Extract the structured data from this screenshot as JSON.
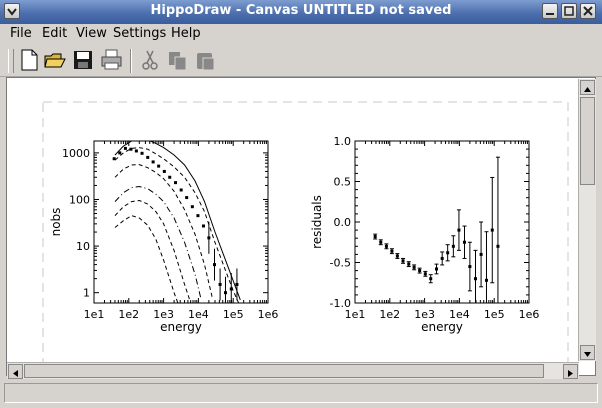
{
  "window": {
    "title": "HippoDraw - Canvas UNTITLED   not saved"
  },
  "menu": {
    "file": "File",
    "edit": "Edit",
    "view": "View",
    "settings": "Settings",
    "help": "Help"
  },
  "toolbar": {
    "icons": [
      "new-file-icon",
      "open-folder-icon",
      "save-icon",
      "print-icon",
      "cut-icon",
      "copy-icon",
      "paste-icon"
    ]
  },
  "chart_data": [
    {
      "type": "line",
      "xlabel": "energy",
      "ylabel": "nobs",
      "xscale": "log",
      "yscale": "log",
      "xticks": [
        "1e1",
        "1e2",
        "1e3",
        "1e4",
        "1e5",
        "1e6"
      ],
      "yticks": [
        "1",
        "10",
        "100",
        "1000"
      ],
      "xlim": [
        10,
        1000000
      ],
      "ylim": [
        0.6,
        1800
      ],
      "points": {
        "x": [
          38,
          55,
          80,
          115,
          165,
          240,
          350,
          500,
          720,
          1050,
          1500,
          2200,
          3200,
          4600,
          6700,
          9700,
          14000,
          20000,
          29000,
          42000,
          60000,
          88000,
          128000
        ],
        "y": [
          750,
          1000,
          1250,
          1200,
          1100,
          980,
          800,
          640,
          520,
          400,
          300,
          230,
          160,
          110,
          70,
          45,
          27,
          15,
          4,
          1.5,
          1.0,
          1.2,
          1.5
        ]
      },
      "curves": [
        {
          "style": "solid",
          "x": [
            40,
            70,
            120,
            200,
            350,
            600,
            1000,
            2000,
            4000,
            8000,
            15000,
            30000,
            60000,
            100000,
            160000
          ],
          "y": [
            900,
            1400,
            1800,
            2000,
            1900,
            1600,
            1300,
            900,
            550,
            250,
            90,
            20,
            5,
            1.8,
            0.7
          ]
        },
        {
          "style": "dashed",
          "x": [
            40,
            70,
            120,
            200,
            350,
            600,
            1000,
            2000,
            4000,
            8000,
            15000,
            30000,
            60000,
            100000,
            160000
          ],
          "y": [
            700,
            1000,
            1250,
            1300,
            1200,
            950,
            750,
            500,
            300,
            140,
            55,
            12,
            3,
            1.1,
            0.5
          ]
        },
        {
          "style": "dashed",
          "x": [
            40,
            70,
            120,
            200,
            350,
            600,
            1000,
            2000,
            4000,
            8000,
            15000,
            25000
          ],
          "y": [
            300,
            450,
            550,
            560,
            480,
            380,
            280,
            150,
            60,
            18,
            4,
            0.8
          ]
        },
        {
          "style": "dash-dot",
          "x": [
            40,
            70,
            120,
            200,
            350,
            600,
            1000,
            2000,
            4000,
            8000,
            12000
          ],
          "y": [
            90,
            140,
            180,
            190,
            170,
            130,
            90,
            40,
            12,
            2.5,
            0.7
          ]
        },
        {
          "style": "dashed",
          "x": [
            40,
            70,
            120,
            200,
            350,
            600,
            1000,
            2000,
            4000,
            6000
          ],
          "y": [
            45,
            70,
            90,
            95,
            80,
            55,
            30,
            8,
            1.5,
            0.6
          ]
        },
        {
          "style": "dashed",
          "x": [
            40,
            70,
            120,
            200,
            350,
            600,
            1000,
            2000,
            2800
          ],
          "y": [
            25,
            35,
            45,
            40,
            28,
            14,
            5,
            1.0,
            0.5
          ]
        }
      ]
    },
    {
      "type": "scatter",
      "xlabel": "energy",
      "ylabel": "residuals",
      "xscale": "log",
      "xticks": [
        "1e1",
        "1e2",
        "1e3",
        "1e4",
        "1e5",
        "1e6"
      ],
      "yticks": [
        "-1.0",
        "-0.5",
        "0.0",
        "0.5",
        "1.0"
      ],
      "xlim": [
        10,
        1000000
      ],
      "ylim": [
        -1.0,
        1.0
      ],
      "x": [
        38,
        55,
        80,
        115,
        165,
        240,
        350,
        500,
        720,
        1050,
        1500,
        2200,
        3200,
        4600,
        6700,
        9700,
        14000,
        20000,
        29000,
        42000,
        60000,
        88000,
        128000
      ],
      "y": [
        -0.18,
        -0.25,
        -0.3,
        -0.36,
        -0.42,
        -0.48,
        -0.52,
        -0.56,
        -0.6,
        -0.64,
        -0.7,
        -0.58,
        -0.45,
        -0.38,
        -0.3,
        -0.1,
        -0.25,
        -0.55,
        -0.7,
        -0.4,
        -0.72,
        -0.1,
        -0.3
      ],
      "err": [
        0.03,
        0.03,
        0.03,
        0.03,
        0.03,
        0.03,
        0.03,
        0.03,
        0.03,
        0.03,
        0.05,
        0.06,
        0.08,
        0.1,
        0.13,
        0.25,
        0.2,
        0.3,
        0.35,
        0.4,
        0.6,
        0.65,
        1.1
      ]
    }
  ]
}
